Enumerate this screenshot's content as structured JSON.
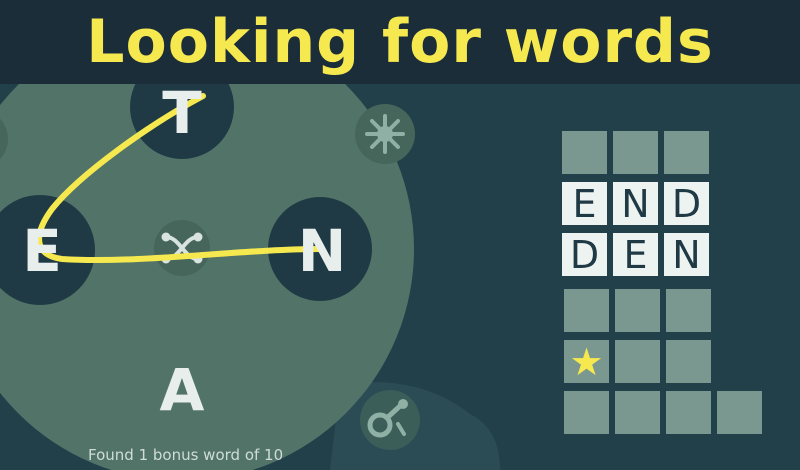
{
  "title": "Looking for words",
  "wheel": {
    "letters": [
      "T",
      "E",
      "N",
      "A"
    ]
  },
  "bonus": {
    "text": "Found 1 bonus word of 10"
  },
  "grid": {
    "row2": [
      "E",
      "N",
      "D"
    ],
    "row3": [
      "D",
      "E",
      "N"
    ]
  },
  "colors": {
    "title": "#f6e94f",
    "trace": "#f6e94f",
    "background": "#22404a",
    "wheel": "#527468",
    "empty_cell": "#7b9890",
    "filled_cell": "#edf3f1"
  },
  "icons": {
    "shuffle": "shuffle-icon",
    "hint": "hint-icon",
    "settings": "settings-icon",
    "bonus": "bonus-words-icon",
    "star": "star-icon"
  }
}
